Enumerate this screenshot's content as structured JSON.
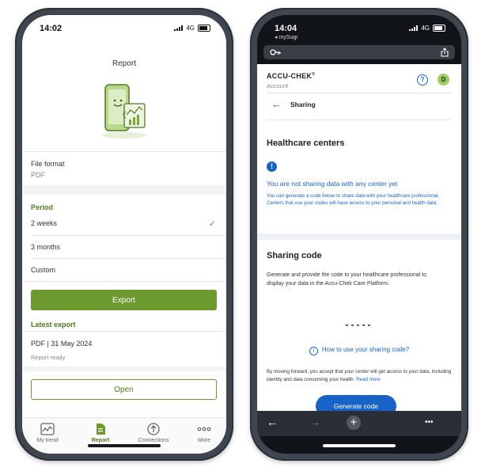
{
  "left": {
    "status": {
      "time": "14:02",
      "network": "4G"
    },
    "title": "Report",
    "file_format": {
      "label": "File format",
      "value": "PDF"
    },
    "period": {
      "heading": "Period",
      "options": [
        {
          "label": "2 weeks",
          "selected": true
        },
        {
          "label": "3 months",
          "selected": false
        },
        {
          "label": "Custom",
          "selected": false
        }
      ],
      "check": "✓"
    },
    "export_label": "Export",
    "latest_export": {
      "heading": "Latest export",
      "value": "PDF | 31 May 2024",
      "status": "Report ready"
    },
    "open_label": "Open",
    "tabs": [
      {
        "label": "My trend",
        "icon": "trend-icon",
        "active": false
      },
      {
        "label": "Report",
        "icon": "report-icon",
        "active": true
      },
      {
        "label": "Connections",
        "icon": "connections-icon",
        "active": false
      },
      {
        "label": "More",
        "icon": "more-icon",
        "active": false
      }
    ],
    "accent": "#6d9a2e"
  },
  "right": {
    "status": {
      "time": "14:04",
      "back_app": "◂ mySugr",
      "network": "4G"
    },
    "brand": "ACCU-CHEK",
    "brand_mark": "®",
    "brand_sub": "Account",
    "help_symbol": "?",
    "avatar_letter": "D",
    "back_symbol": "←",
    "page_title": "Sharing",
    "healthcare": {
      "heading": "Healthcare centers",
      "info_symbol": "!",
      "notice_title": "You are not sharing data with any center yet",
      "notice_body": "You can generate a code below to share data with your healthcare professional. Centers that use your codes will have access to your personal and health data."
    },
    "sharing_code": {
      "heading": "Sharing code",
      "body": "Generate and provide the code to your healthcare professional to display your data in the Accu-Chek Care Platform.",
      "placeholder": "-----",
      "howto": "How to use your sharing code?",
      "howto_symbol": "i",
      "consent": "By moving forward, you accept that your center will get access to your data, including identity and data concerning your health.",
      "read_more": "Read more",
      "button": "Generate code"
    },
    "browser": {
      "back": "←",
      "forward": "→",
      "plus": "+",
      "menu": "•••"
    },
    "accent": "#1763c8"
  }
}
